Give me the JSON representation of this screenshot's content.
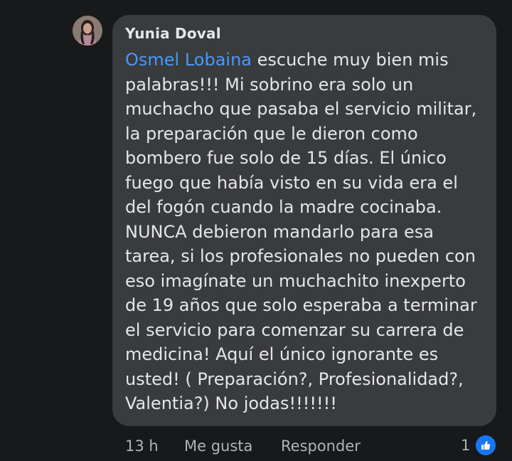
{
  "comment": {
    "author": "Yunia Doval",
    "mention": "Osmel Lobaina",
    "text_after_mention": " escuche muy bien mis\npalabras!!! Mi sobrino era solo un\nmuchacho que pasaba el servicio militar,\nla preparación que le dieron como\nbombero fue solo de 15 días. El único\nfuego que había visto en su vida era el\ndel fogón cuando la madre cocinaba.\nNUNCA debieron mandarlo para esa\ntarea, si los profesionales no pueden con\neso imagínate un muchachito inexperto\nde 19 años que solo esperaba a terminar\nel servicio para comenzar su carrera de\nmedicina! Aquí el único ignorante es\nusted! ( Preparación?, Profesionalidad?,\nValentia?) No jodas!!!!!!!"
  },
  "actions": {
    "time": "13 h",
    "like_label": "Me gusta",
    "reply_label": "Responder"
  },
  "reactions": {
    "count": "1",
    "icon": "thumbs-up-icon",
    "color": "#1877f2"
  },
  "colors": {
    "background": "#18191a",
    "bubble": "#3a3b3c",
    "text": "#e4e6eb",
    "mention": "#4599ff",
    "secondary": "#b0b3b8"
  }
}
